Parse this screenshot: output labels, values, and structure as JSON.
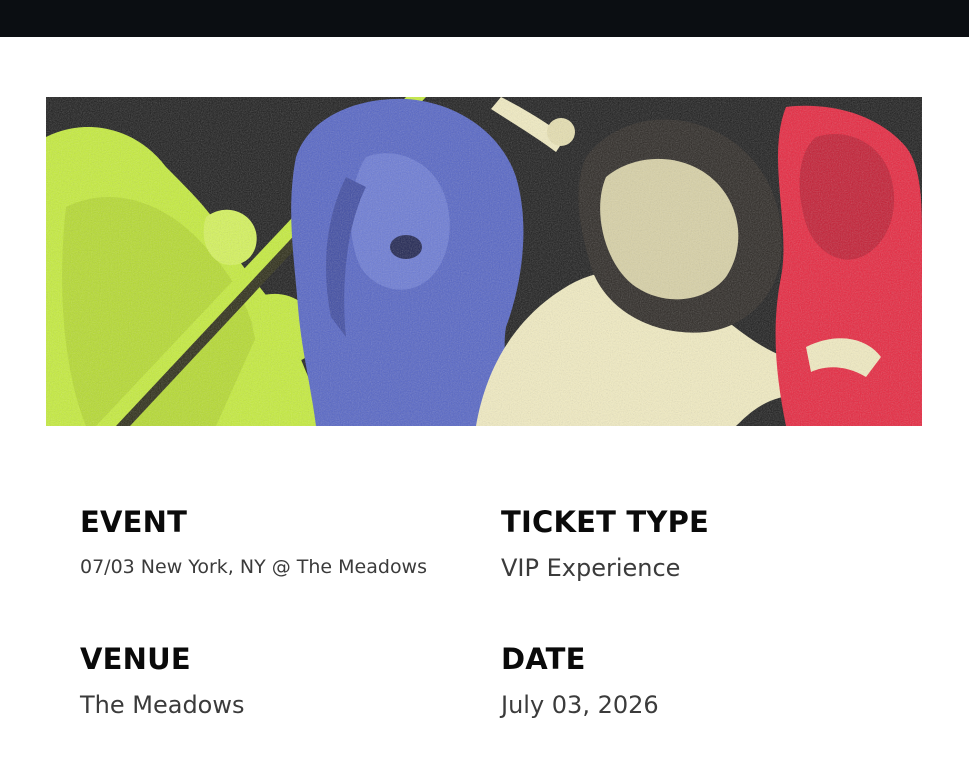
{
  "banner": {
    "image_name": "band-collage-artwork",
    "colors": {
      "background": "#1b1b1b",
      "lime": "#c6ee3a",
      "blue": "#5464c6",
      "cream": "#f3edc2",
      "red": "#e8243d"
    }
  },
  "details": {
    "event": {
      "label": "EVENT",
      "value": "07/03 New York, NY @ The Meadows"
    },
    "ticket": {
      "label": "TICKET TYPE",
      "value": "VIP Experience"
    },
    "venue": {
      "label": "VENUE",
      "value": "The Meadows"
    },
    "date": {
      "label": "DATE",
      "value": "July 03, 2026"
    }
  },
  "colors": {
    "topbar": "#0b0e12",
    "label": "#0a0a0a",
    "value": "#3b3b3b"
  }
}
